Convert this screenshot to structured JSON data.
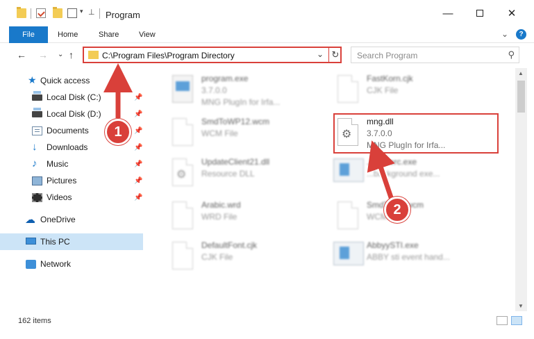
{
  "window": {
    "title": "Program",
    "minimize_icon": "minimize-icon",
    "maximize_icon": "maximize-icon",
    "close_icon": "close-icon"
  },
  "ribbon": {
    "tabs": [
      "File",
      "Home",
      "Share",
      "View"
    ]
  },
  "nav": {
    "back": "←",
    "forward": "→",
    "recent": "⌄",
    "up": "↑"
  },
  "address": {
    "path": "C:\\Program Files\\Program Directory"
  },
  "search": {
    "placeholder": "Search Program"
  },
  "sidebar": {
    "items": [
      {
        "label": "Quick access"
      },
      {
        "label": "Local Disk (C:)"
      },
      {
        "label": "Local Disk (D:)"
      },
      {
        "label": "Documents"
      },
      {
        "label": "Downloads"
      },
      {
        "label": "Music"
      },
      {
        "label": "Pictures"
      },
      {
        "label": "Videos"
      },
      {
        "label": "OneDrive"
      },
      {
        "label": "This PC"
      },
      {
        "label": "Network"
      }
    ]
  },
  "files": [
    {
      "name": "program.exe",
      "line2": "3.7.0.0",
      "line3": "MNG PlugIn for Irfa..."
    },
    {
      "name": "FastKorn.cjk",
      "line2": "CJK File",
      "line3": ""
    },
    {
      "name": "SmdToWP12.wcm",
      "line2": "WCM File",
      "line3": ""
    },
    {
      "name": "mng.dll",
      "line2": "3.7.0.0",
      "line3": "MNG PlugIn for Irfa..."
    },
    {
      "name": "UpdateClient21.dll",
      "line2": "Resource DLL",
      "line3": ""
    },
    {
      "name": "...serverc.exe",
      "line2": "...background exe...",
      "line3": ""
    },
    {
      "name": "Arabic.wrd",
      "line2": "WRD File",
      "line3": ""
    },
    {
      "name": "SmdTo...6.wcm",
      "line2": "WCM ...",
      "line3": ""
    },
    {
      "name": "DefaultFont.cjk",
      "line2": "CJK File",
      "line3": ""
    },
    {
      "name": "AbbyySTI.exe",
      "line2": "ABBY sti event hand...",
      "line3": ""
    }
  ],
  "status": {
    "item_count": "162 items"
  },
  "annotations": {
    "step1": "1",
    "step2": "2",
    "accent_color": "#d9403a"
  }
}
